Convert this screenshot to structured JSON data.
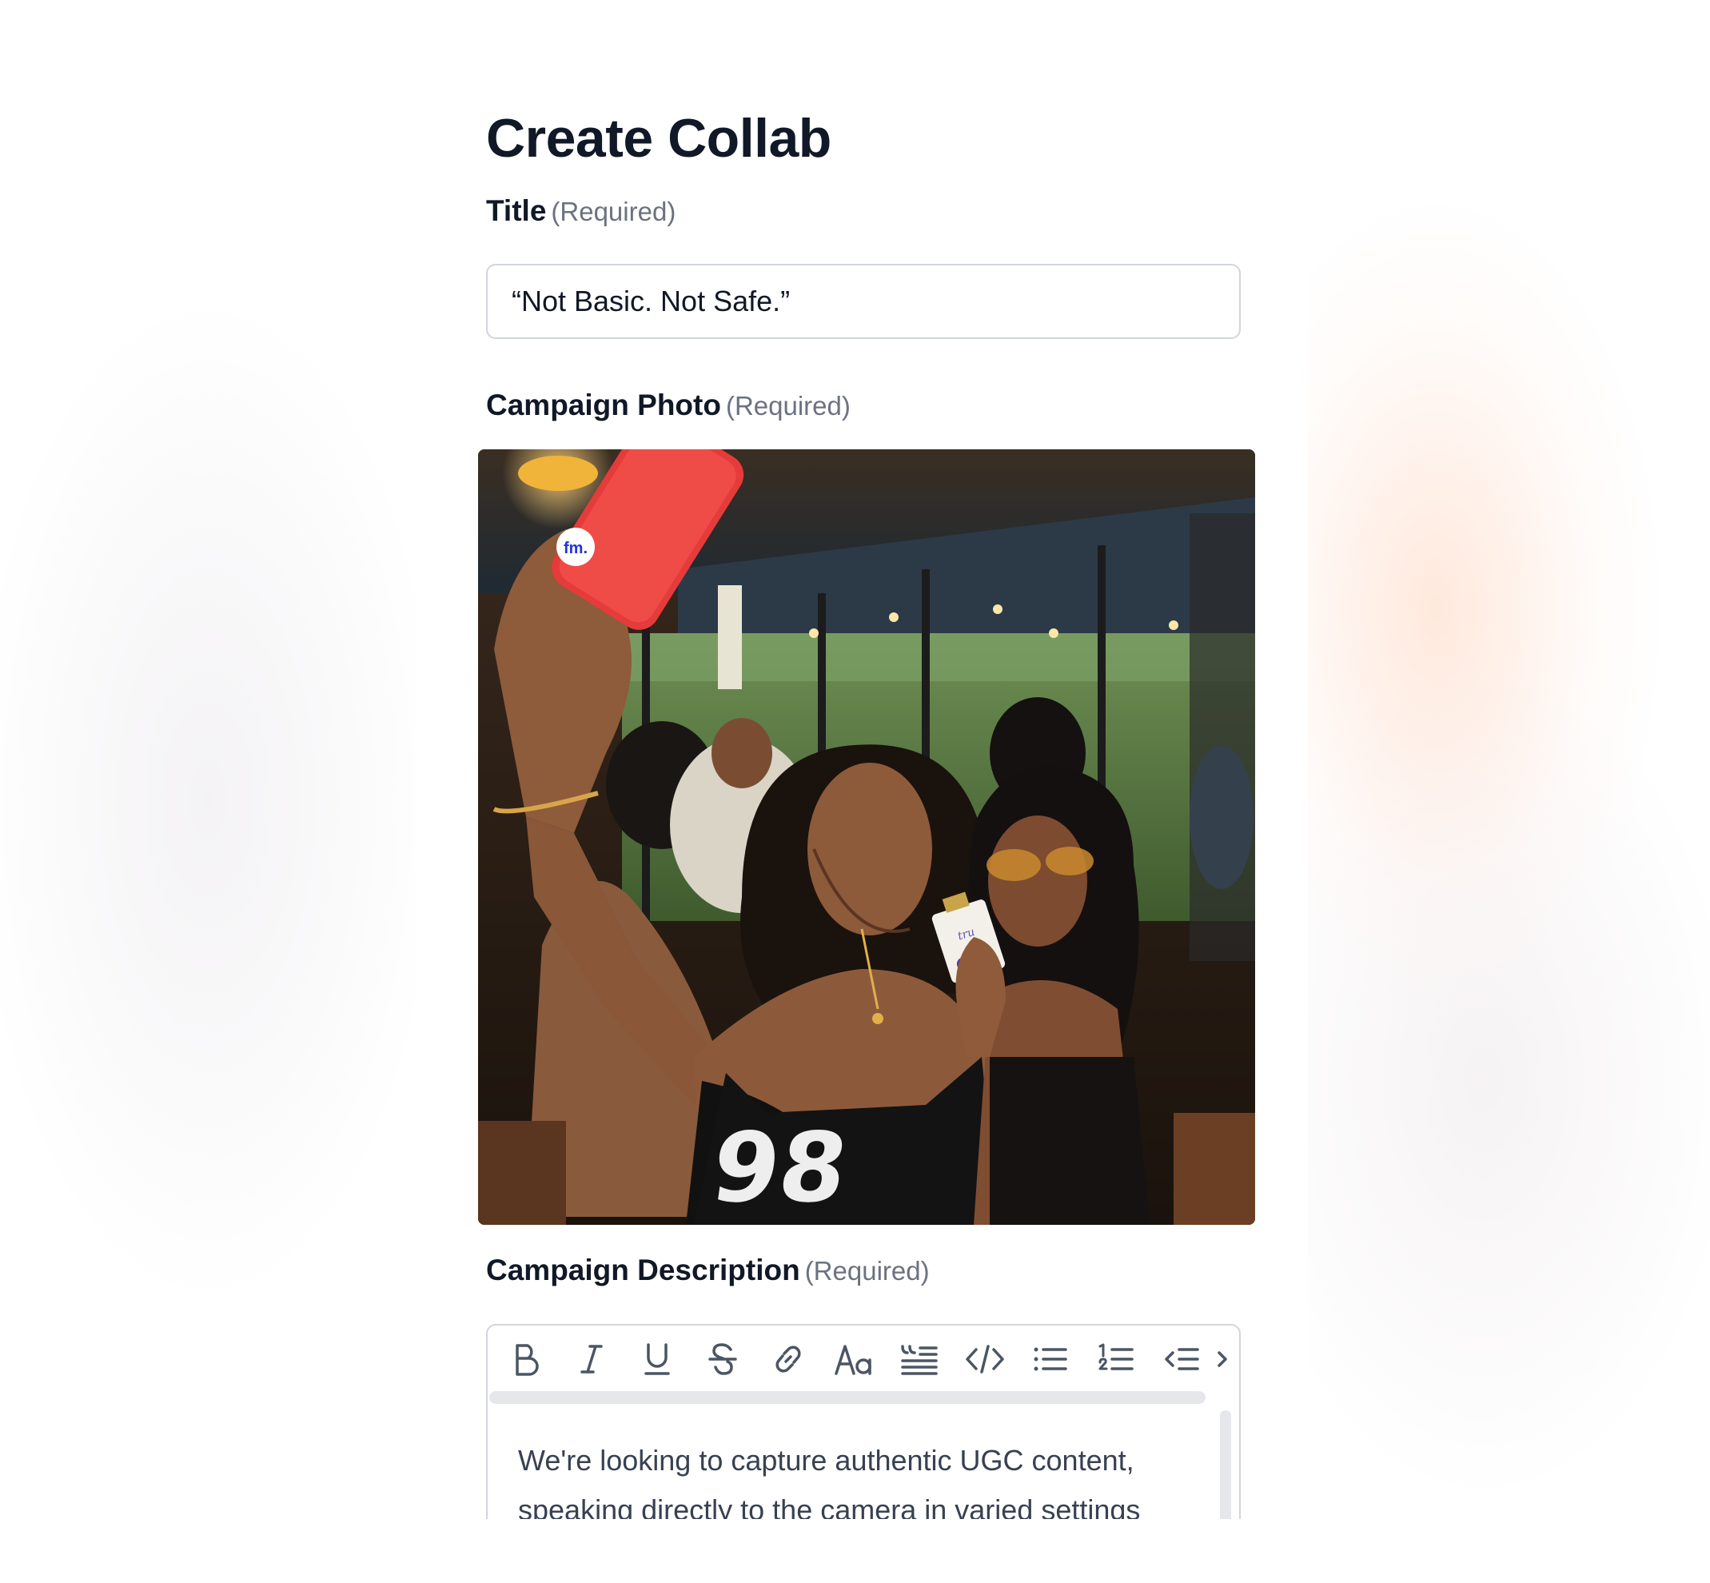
{
  "page": {
    "title": "Create Collab"
  },
  "form": {
    "title_field": {
      "label": "Title",
      "required_text": "(Required)",
      "value": "“Not Basic. Not Safe.”"
    },
    "photo_field": {
      "label": "Campaign Photo",
      "required_text": "(Required)",
      "photo_badge": "fm.",
      "jersey_number": "98"
    },
    "description_field": {
      "label": "Campaign Description",
      "required_text": "(Required)",
      "toolbar": [
        {
          "name": "bold",
          "icon": "bold-icon"
        },
        {
          "name": "italic",
          "icon": "italic-icon"
        },
        {
          "name": "underline",
          "icon": "underline-icon"
        },
        {
          "name": "strikethrough",
          "icon": "strikethrough-icon"
        },
        {
          "name": "link",
          "icon": "link-icon"
        },
        {
          "name": "font-size",
          "icon": "font-size-icon"
        },
        {
          "name": "blockquote",
          "icon": "blockquote-icon"
        },
        {
          "name": "code",
          "icon": "code-icon"
        },
        {
          "name": "bullet-list",
          "icon": "bullet-list-icon"
        },
        {
          "name": "numbered-list",
          "icon": "numbered-list-icon"
        },
        {
          "name": "outdent",
          "icon": "outdent-icon"
        },
        {
          "name": "more",
          "icon": "chevron-right-icon"
        }
      ],
      "text_line_1": "We're looking to capture authentic UGC content,",
      "text_line_2": "speaking directly to the camera in varied settings"
    }
  },
  "colors": {
    "heading": "#111827",
    "muted": "#6b7280",
    "border": "#d1d5db",
    "icon": "#4b5563"
  }
}
